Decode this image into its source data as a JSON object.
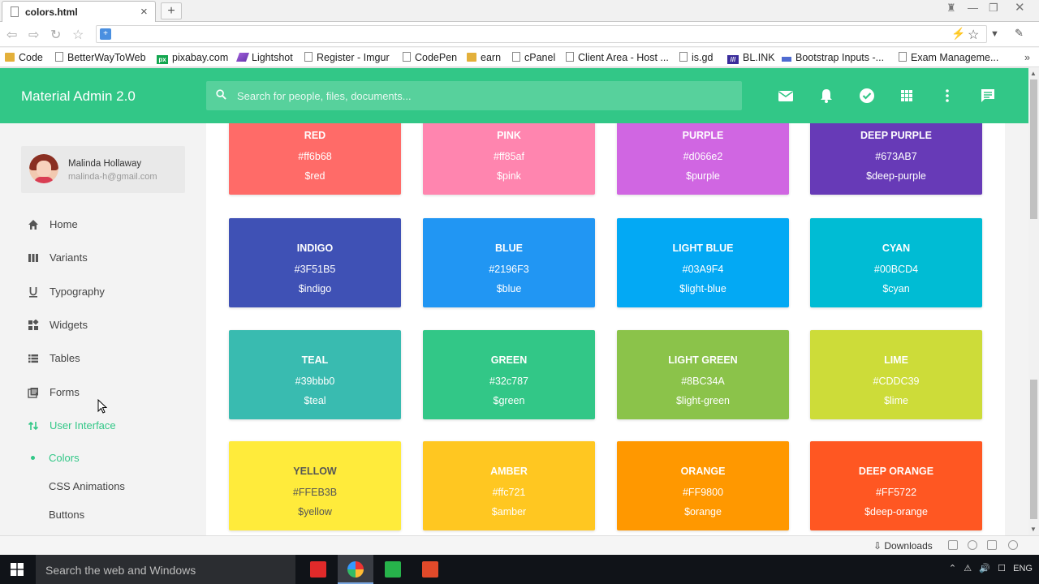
{
  "browser": {
    "tab_title": "colors.html",
    "new_tab_label": "+",
    "close_tab_label": "×",
    "bookmarks": [
      {
        "label": "Code",
        "icon": "folder-icon"
      },
      {
        "label": "BetterWayToWeb",
        "icon": "page-icon"
      },
      {
        "label": "pixabay.com",
        "icon": "pixabay-icon"
      },
      {
        "label": "Lightshot",
        "icon": "lightshot-icon"
      },
      {
        "label": "Register - Imgur",
        "icon": "page-icon"
      },
      {
        "label": "CodePen",
        "icon": "page-icon"
      },
      {
        "label": "earn",
        "icon": "folder-icon"
      },
      {
        "label": "cPanel",
        "icon": "page-icon"
      },
      {
        "label": "Client Area - Host ...",
        "icon": "page-icon"
      },
      {
        "label": "is.gd",
        "icon": "page-icon"
      },
      {
        "label": "BL.INK",
        "icon": "blink-icon"
      },
      {
        "label": "Bootstrap Inputs -...",
        "icon": "bootstrap-icon"
      },
      {
        "label": "Exam Manageme...",
        "icon": "page-icon"
      }
    ]
  },
  "app": {
    "brand": "Material Admin 2.0",
    "search_placeholder": "Search for people, files, documents...",
    "header_icons": [
      "mail-icon",
      "bell-icon",
      "check-circle-icon",
      "apps-grid-icon",
      "more-vert-icon",
      "chat-icon"
    ],
    "accent_color": "#32c787"
  },
  "profile": {
    "name": "Malinda Hollaway",
    "email": "malinda-h@gmail.com"
  },
  "nav": {
    "items": [
      {
        "label": "Home",
        "icon": "home-icon"
      },
      {
        "label": "Variants",
        "icon": "columns-icon"
      },
      {
        "label": "Typography",
        "icon": "underline-icon"
      },
      {
        "label": "Widgets",
        "icon": "widgets-icon"
      },
      {
        "label": "Tables",
        "icon": "table-icon"
      },
      {
        "label": "Forms",
        "icon": "form-icon"
      },
      {
        "label": "User Interface",
        "icon": "swap-icon",
        "active": true
      }
    ],
    "sub_items": [
      {
        "label": "Colors",
        "active": true
      },
      {
        "label": "CSS Animations"
      },
      {
        "label": "Buttons"
      }
    ]
  },
  "colors": [
    {
      "name": "RED",
      "hex": "#ff6b68",
      "var": "$red",
      "bg": "#ff6b68",
      "text": "#ffffff"
    },
    {
      "name": "PINK",
      "hex": "#ff85af",
      "var": "$pink",
      "bg": "#ff85af",
      "text": "#ffffff"
    },
    {
      "name": "PURPLE",
      "hex": "#d066e2",
      "var": "$purple",
      "bg": "#d066e2",
      "text": "#ffffff"
    },
    {
      "name": "DEEP PURPLE",
      "hex": "#673AB7",
      "var": "$deep-purple",
      "bg": "#673AB7",
      "text": "#ffffff"
    },
    {
      "name": "INDIGO",
      "hex": "#3F51B5",
      "var": "$indigo",
      "bg": "#3F51B5",
      "text": "#ffffff"
    },
    {
      "name": "BLUE",
      "hex": "#2196F3",
      "var": "$blue",
      "bg": "#2196F3",
      "text": "#ffffff"
    },
    {
      "name": "LIGHT BLUE",
      "hex": "#03A9F4",
      "var": "$light-blue",
      "bg": "#03A9F4",
      "text": "#ffffff"
    },
    {
      "name": "CYAN",
      "hex": "#00BCD4",
      "var": "$cyan",
      "bg": "#00BCD4",
      "text": "#ffffff"
    },
    {
      "name": "TEAL",
      "hex": "#39bbb0",
      "var": "$teal",
      "bg": "#39bbb0",
      "text": "#ffffff"
    },
    {
      "name": "GREEN",
      "hex": "#32c787",
      "var": "$green",
      "bg": "#32c787",
      "text": "#ffffff"
    },
    {
      "name": "LIGHT GREEN",
      "hex": "#8BC34A",
      "var": "$light-green",
      "bg": "#8BC34A",
      "text": "#ffffff"
    },
    {
      "name": "LIME",
      "hex": "#CDDC39",
      "var": "$lime",
      "bg": "#CDDC39",
      "text": "#ffffff"
    },
    {
      "name": "YELLOW",
      "hex": "#FFEB3B",
      "var": "$yellow",
      "bg": "#FFEB3B",
      "text": "#555555"
    },
    {
      "name": "AMBER",
      "hex": "#ffc721",
      "var": "$amber",
      "bg": "#ffc721",
      "text": "#ffffff"
    },
    {
      "name": "ORANGE",
      "hex": "#FF9800",
      "var": "$orange",
      "bg": "#FF9800",
      "text": "#ffffff"
    },
    {
      "name": "DEEP ORANGE",
      "hex": "#FF5722",
      "var": "$deep-orange",
      "bg": "#FF5722",
      "text": "#ffffff"
    }
  ],
  "downloads_bar": {
    "label": "Downloads"
  },
  "taskbar": {
    "search_placeholder": "Search the web and Windows",
    "tray_lang": "ENG"
  }
}
